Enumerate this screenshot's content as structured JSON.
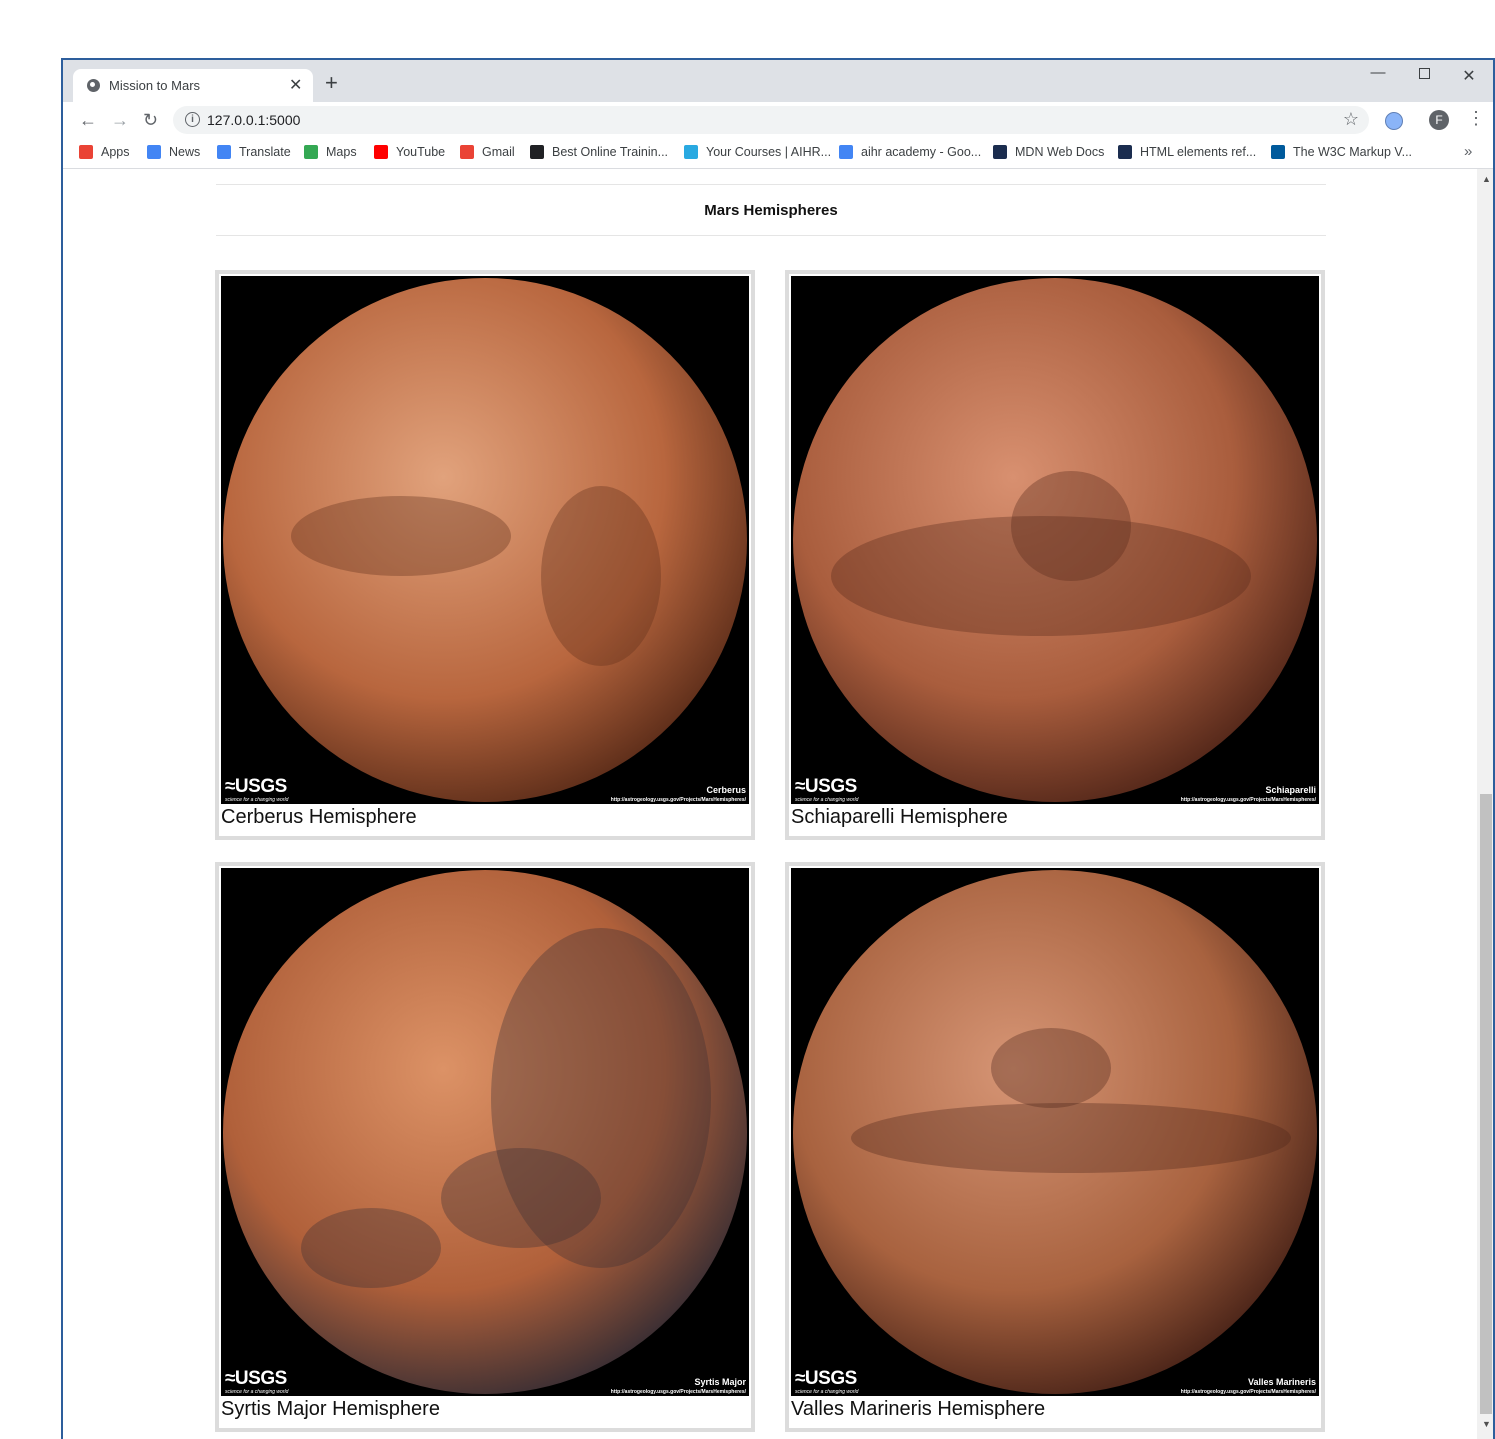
{
  "browser": {
    "tab_title": "Mission to Mars",
    "tab_close": "✕",
    "new_tab": "+",
    "window_controls": {
      "minimize": "—",
      "close": "✕"
    },
    "nav": {
      "back": "←",
      "forward": "→",
      "reload": "↻"
    },
    "url": "127.0.0.1:5000",
    "info_symbol": "i",
    "star": "☆",
    "profile_initial": "F",
    "menu": "⋮",
    "more_bookmarks": "»",
    "bookmarks": [
      {
        "label": "Apps",
        "icon": "apps-grid-icon",
        "color": "#ea4335"
      },
      {
        "label": "News",
        "icon": "google-news-icon",
        "color": "#4285f4"
      },
      {
        "label": "Translate",
        "icon": "google-translate-icon",
        "color": "#4285f4"
      },
      {
        "label": "Maps",
        "icon": "google-maps-icon",
        "color": "#34a853"
      },
      {
        "label": "YouTube",
        "icon": "youtube-icon",
        "color": "#ff0000"
      },
      {
        "label": "Gmail",
        "icon": "gmail-icon",
        "color": "#ea4335"
      },
      {
        "label": "Best Online Trainin...",
        "icon": "training-site-icon",
        "color": "#202124"
      },
      {
        "label": "Your Courses | AIHR...",
        "icon": "aihr-icon",
        "color": "#29a9e1"
      },
      {
        "label": "aihr academy - Goo...",
        "icon": "google-search-icon",
        "color": "#4285f4"
      },
      {
        "label": "MDN Web Docs",
        "icon": "mdn-icon",
        "color": "#1b2d4f"
      },
      {
        "label": "HTML elements ref...",
        "icon": "mdn-icon",
        "color": "#1b2d4f"
      },
      {
        "label": "The W3C Markup V...",
        "icon": "w3c-icon",
        "color": "#005a9c"
      }
    ]
  },
  "page": {
    "section_title": "Mars Hemispheres",
    "hemispheres": [
      {
        "title": "Cerberus Hemisphere",
        "image_label": "Cerberus",
        "image_brand": "≈USGS",
        "image_tagline": "science for a changing world",
        "image_url": "http://astrogeology.usgs.gov/Projects/MarsHemispheres/",
        "colors": {
          "light": "#e1a27c",
          "mid": "#b8663e",
          "dark": "#5e2e1a"
        }
      },
      {
        "title": "Schiaparelli Hemisphere",
        "image_label": "Schiaparelli",
        "image_brand": "≈USGS",
        "image_tagline": "science for a changing world",
        "image_url": "http://astrogeology.usgs.gov/Projects/MarsHemispheres/",
        "colors": {
          "light": "#d89070",
          "mid": "#a95d3d",
          "dark": "#55281a"
        }
      },
      {
        "title": "Syrtis Major Hemisphere",
        "image_label": "Syrtis Major",
        "image_brand": "≈USGS",
        "image_tagline": "science for a changing world",
        "image_url": "http://astrogeology.usgs.gov/Projects/MarsHemispheres/",
        "colors": {
          "light": "#dc9266",
          "mid": "#b0603a",
          "dark": "#3a2e33"
        }
      },
      {
        "title": "Valles Marineris Hemisphere",
        "image_label": "Valles Marineris",
        "image_brand": "≈USGS",
        "image_tagline": "science for a changing world",
        "image_url": "http://astrogeology.usgs.gov/Projects/MarsHemispheres/",
        "colors": {
          "light": "#d69575",
          "mid": "#a8623f",
          "dark": "#4c2519"
        }
      }
    ]
  }
}
